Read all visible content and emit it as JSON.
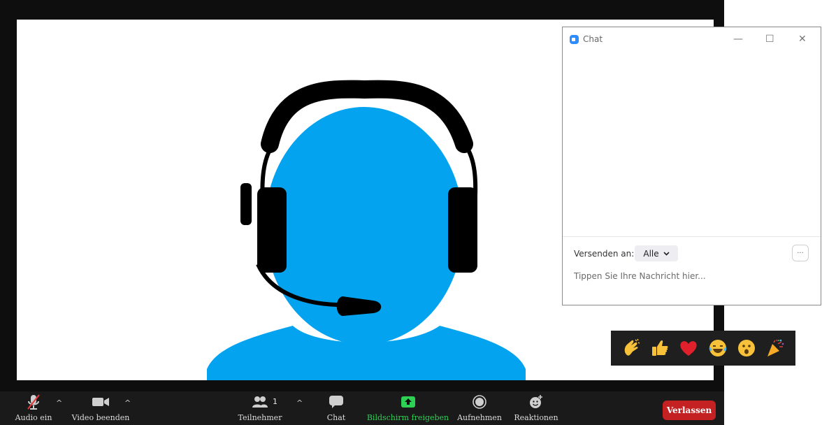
{
  "toolbar": {
    "audio_label": "Audio ein",
    "video_label": "Video beenden",
    "participants_label": "Teilnehmer",
    "participants_count": "1",
    "chat_label": "Chat",
    "share_label": "Bildschirm freigeben",
    "record_label": "Aufnehmen",
    "reactions_label": "Reaktionen",
    "leave_label": "Verlassen",
    "caret": "^"
  },
  "chat": {
    "title": "Chat",
    "minimize": "—",
    "maximize": "☐",
    "close": "✕",
    "send_to_label": "Versenden an:",
    "recipient": "Alle",
    "more": "···",
    "placeholder": "Tippen Sie Ihre Nachricht hier..."
  },
  "reactions": [
    "clap",
    "thumbs-up",
    "heart",
    "joy",
    "open-mouth",
    "tada"
  ],
  "colors": {
    "avatar": "#03a3ef",
    "share_green": "#2dd153",
    "leave_red": "#c42123",
    "zoom_blue": "#2d8cff"
  }
}
